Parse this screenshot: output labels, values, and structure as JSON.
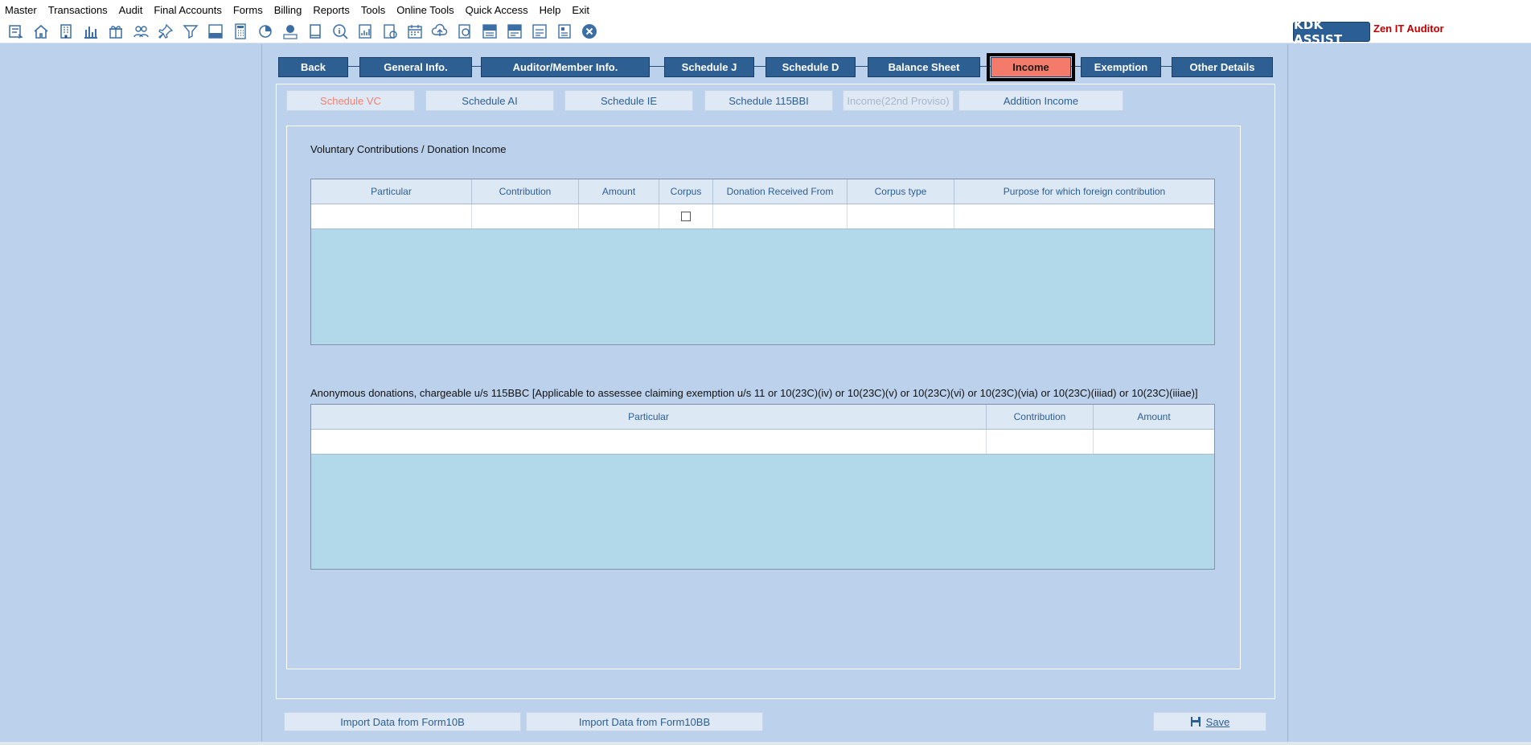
{
  "menubar": {
    "items": [
      "Master",
      "Transactions",
      "Audit",
      "Final Accounts",
      "Forms",
      "Billing",
      "Reports",
      "Tools",
      "Online Tools",
      "Quick Access",
      "Help",
      "Exit"
    ]
  },
  "toolbar": {
    "icons": [
      "exchange-icon",
      "home-icon",
      "building-icon",
      "bar-chart-icon",
      "gift-icon",
      "users-icon",
      "pin-icon",
      "filter-icon",
      "tax-icon",
      "calculator-icon",
      "pie-chart-icon",
      "pay-icon",
      "book-icon",
      "info-search-icon",
      "ledger-icon",
      "report-icon",
      "calendar-icon",
      "upload-icon",
      "refresh-icon",
      "bs-icon",
      "bs-sch-icon",
      "scd-icon",
      "grid-report-icon",
      "close-circle-icon"
    ],
    "brand": "KDK ASSIST",
    "app_name": "Zen IT Auditor"
  },
  "nav": {
    "tabs": [
      "Back",
      "General Info.",
      "Auditor/Member Info.",
      "Schedule J",
      "Schedule D",
      "Balance Sheet",
      "Income",
      "Exemption",
      "Other Details"
    ],
    "active": "Income"
  },
  "subtabs": {
    "items": [
      "Schedule VC",
      "Schedule AI",
      "Schedule IE",
      "Schedule 115BBI",
      "Income(22nd Proviso)",
      "Addition Income"
    ],
    "active": "Schedule VC",
    "disabled": "Income(22nd Proviso)"
  },
  "voluntary": {
    "title": "Voluntary Contributions / Donation Income",
    "columns": [
      "Particular",
      "Contribution",
      "Amount",
      "Corpus",
      "Donation Received From",
      "Corpus type",
      "Purpose for which foreign contribution"
    ],
    "rows": [
      {
        "particular": "",
        "contribution": "",
        "amount": "",
        "corpus": false,
        "received_from": "",
        "corpus_type": "",
        "purpose": ""
      }
    ]
  },
  "anonymous": {
    "title": "Anonymous donations, chargeable u/s 115BBC [Applicable to assessee claiming exemption u/s 11 or 10(23C)(iv) or 10(23C)(v) or 10(23C)(vi) or 10(23C)(via) or 10(23C)(iiiad) or 10(23C)(iiiae)]",
    "columns": [
      "Particular",
      "Contribution",
      "Amount"
    ],
    "rows": [
      {
        "particular": "",
        "contribution": "",
        "amount": ""
      }
    ]
  },
  "actions": {
    "import_10b": "Import Data from Form10B",
    "import_10bb": "Import Data from Form10BB",
    "save": "Save"
  },
  "colors": {
    "nav_bg": "#2e5f92",
    "active_tab": "#f47a6a",
    "grid_fill": "#b2d9ea",
    "page_bg": "#bcd2ec"
  }
}
